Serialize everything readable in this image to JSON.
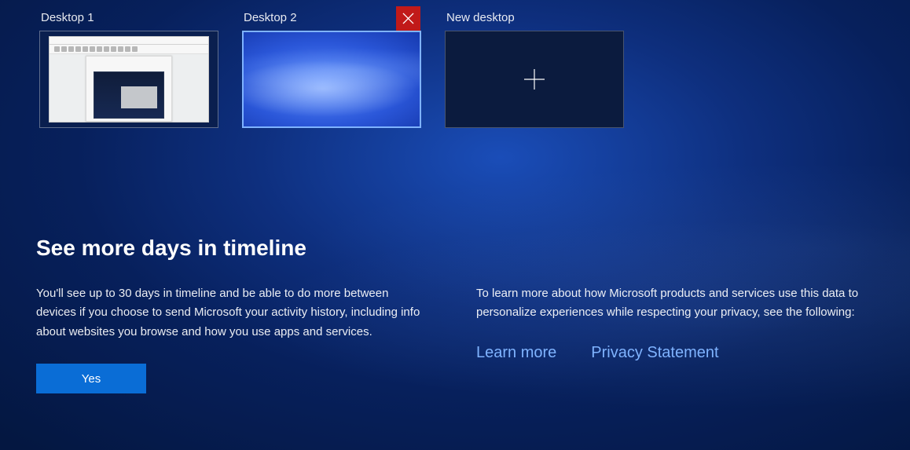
{
  "desktops": {
    "items": [
      {
        "label": "Desktop 1"
      },
      {
        "label": "Desktop 2"
      }
    ],
    "new_label": "New desktop"
  },
  "timeline_prompt": {
    "heading": "See more days in timeline",
    "left_text": "You'll see up to 30 days in timeline and be able to do more between devices if you choose to send Microsoft your activity history, including info about websites you browse and how you use apps and services.",
    "right_text": "To learn more about how Microsoft products and services use this data to personalize experiences while respecting your privacy, see the following:",
    "learn_more": "Learn more",
    "privacy_statement": "Privacy Statement",
    "yes": "Yes"
  },
  "accent_color": "#0a6dd6"
}
